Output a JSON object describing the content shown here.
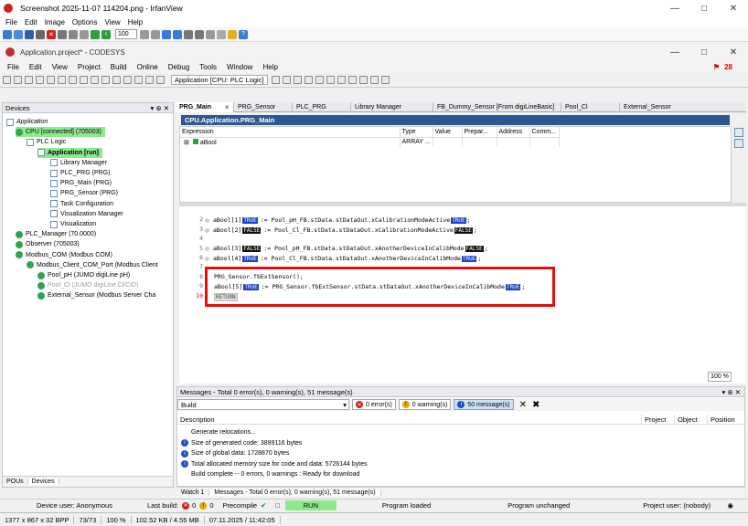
{
  "irfanview": {
    "title": "Screenshot 2025-11-07 114204.png - IrfanView",
    "menu": [
      "File",
      "Edit",
      "Image",
      "Options",
      "View",
      "Help"
    ],
    "zoom": "100",
    "status": [
      "1377 x 867 x 32 BPP",
      "73/73",
      "100 %",
      "102.52 KB / 4.55 MB",
      "07.11.2025 / 11:42:05"
    ]
  },
  "codesys": {
    "title": "Application.project* - CODESYS",
    "menu": [
      "File",
      "Edit",
      "View",
      "Project",
      "Build",
      "Online",
      "Debug",
      "Tools",
      "Window",
      "Help"
    ],
    "app_selector": "Application [CPU: PLC Logic]",
    "notification_count": "28"
  },
  "devices": {
    "title": "Devices",
    "tree": [
      {
        "label": "Application",
        "indent": 0,
        "style": "italic"
      },
      {
        "label": "CPU [connected] (705003)",
        "indent": 1,
        "hl": true
      },
      {
        "label": "PLC Logic",
        "indent": 2
      },
      {
        "label": "Application [run]",
        "indent": 3,
        "hl": true,
        "bold": true
      },
      {
        "label": "Library Manager",
        "indent": 4
      },
      {
        "label": "PLC_PRG (PRG)",
        "indent": 4
      },
      {
        "label": "PRG_Main (PRG)",
        "indent": 4
      },
      {
        "label": "PRG_Sensor (PRG)",
        "indent": 4
      },
      {
        "label": "Task Configuration",
        "indent": 4
      },
      {
        "label": "Visualization Manager",
        "indent": 4
      },
      {
        "label": "Visualization",
        "indent": 4
      },
      {
        "label": "PLC_Manager (70.0000)",
        "indent": 1
      },
      {
        "label": "Observer (705003)",
        "indent": 1
      },
      {
        "label": "Modbus_COM (Modbus COM)",
        "indent": 1
      },
      {
        "label": "Modbus_Client_COM_Port (Modbus Client",
        "indent": 2
      },
      {
        "label": "Pool_pH (JUMO digiLine pH)",
        "indent": 3
      },
      {
        "label": "Pool_Cl (JUMO digiLine Cl/ClO)",
        "indent": 3,
        "gray": true
      },
      {
        "label": "External_Sensor (Modbus Server Cha",
        "indent": 3
      }
    ],
    "bottom_tabs": [
      "POUs",
      "Devices"
    ]
  },
  "editor": {
    "tabs": [
      "PRG_Main",
      "PRG_Sensor",
      "PLC_PRG",
      "Library Manager",
      "FB_Dummy_Sensor [From digiLineBasic]",
      "Pool_Cl",
      "External_Sensor"
    ],
    "header": "CPU.Application.PRG_Main",
    "watch_columns": [
      "Expression",
      "Type",
      "Value",
      "Prepar...",
      "Address",
      "Comm..."
    ],
    "watch_rows": [
      {
        "expression": "aBool",
        "type": "ARRAY ..."
      }
    ],
    "zoom": "100 %"
  },
  "code": {
    "lines": [
      {
        "n": "2",
        "text": "aBool[1]",
        "val": "TRUE",
        "rest": ":= Pool_pH_FB.stData.stDataOut.xCalibrationModeActive",
        "val2": "TRUE",
        "end": ";"
      },
      {
        "n": "3",
        "text": "aBool[2]",
        "val": "FALSE",
        "rest": ":= Pool_Cl_FB.stData.stDataOut.xCalibrationModeActive",
        "val2": "FALSE",
        "end": ";"
      },
      {
        "n": "5",
        "text": "aBool[3]",
        "val": "FALSE",
        "rest": ":= Pool_pH_FB.stData.stDataOut.xAnotherDeviceInCalibMode",
        "val2": "FALSE",
        "end": ";"
      },
      {
        "n": "6",
        "text": "aBool[4]",
        "val": "TRUE",
        "rest": ":= Pool_Cl_FB.stData.stDataOut.xAnotherDeviceInCalibMode",
        "val2": "TRUE",
        "end": ";"
      },
      {
        "n": "8",
        "text": "PRG_Sensor.fbExtSensor();"
      },
      {
        "n": "9",
        "text": "aBool[5]",
        "val": "TRUE",
        "rest": ":= PRG_Sensor.fbExtSensor.stData.stDataOut.xAnotherDeviceInCalibMode",
        "val2": "TRUE",
        "end": ";"
      },
      {
        "n": "10",
        "ret": "RETURN"
      }
    ]
  },
  "messages": {
    "title": "Messages - Total 0 error(s), 0 warning(s), 51 message(s)",
    "build": "Build",
    "errors": "0 error(s)",
    "warnings": "0 warning(s)",
    "msgs": "50 message(s)",
    "columns": [
      "Description",
      "Project",
      "Object",
      "Position"
    ],
    "lines": [
      {
        "icon": "",
        "text": "Generate relocations..."
      },
      {
        "icon": "i",
        "text": "Size of generated code: 3899116 bytes"
      },
      {
        "icon": "i",
        "text": "Size of global data: 1728870 bytes"
      },
      {
        "icon": "i",
        "text": "Total allocated memory size for code and data: 5726144 bytes"
      },
      {
        "icon": "",
        "text": "Build complete -- 0 errors, 0 warnings : Ready for download"
      }
    ],
    "bottom_tabs": [
      "Watch 1",
      "Messages - Total 0 error(s), 0 warning(s), 51 message(s)"
    ]
  },
  "statusbar": {
    "device_user": "Device user: Anonymous",
    "last_build_label": "Last build:",
    "last_build_err": "0",
    "last_build_warn": "0",
    "precompile": "Precompile",
    "run": "RUN",
    "program_loaded": "Program loaded",
    "program_unchanged": "Program unchanged",
    "project_user": "Project user: (nobody)"
  }
}
